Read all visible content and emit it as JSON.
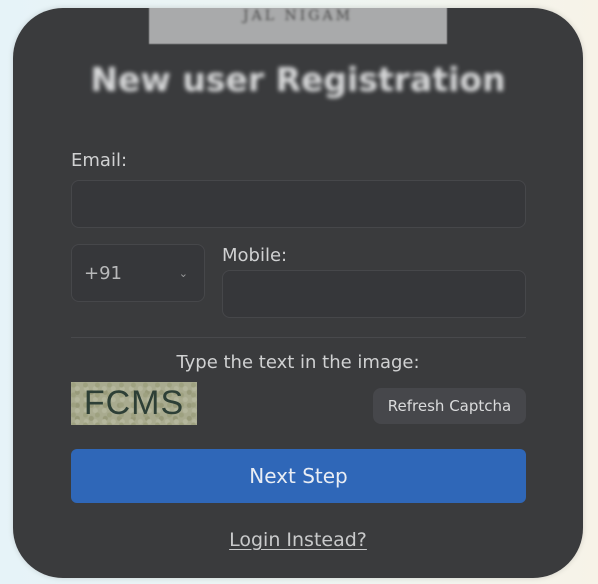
{
  "form": {
    "title": "New user Registration",
    "email_label": "Email:",
    "email_value": "",
    "country_code": "+91",
    "mobile_label": "Mobile:",
    "mobile_value": "",
    "captcha_label": "Type the text in the image:",
    "captcha_text": "FCMS",
    "refresh_captcha_label": "Refresh Captcha",
    "next_step_label": "Next Step",
    "login_instead_label": "Login Instead?"
  },
  "colors": {
    "card_background": "#3a3b3d",
    "primary_button": "#2f67b8",
    "text": "#d0d1d2"
  }
}
